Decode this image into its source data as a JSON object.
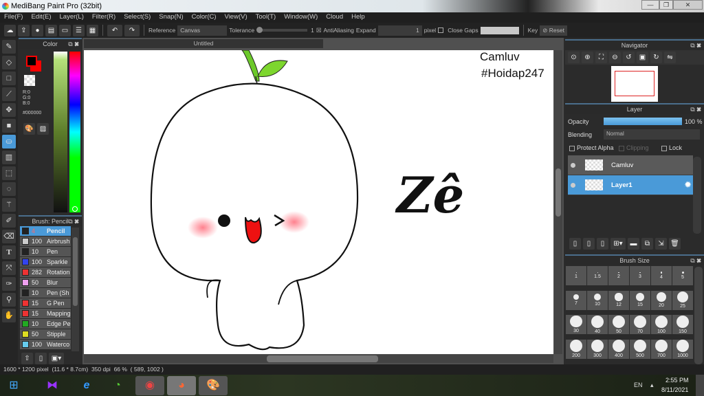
{
  "window": {
    "title": "MediBang Paint Pro (32bit)",
    "minimize": "—",
    "restore": "❐",
    "close": "✕"
  },
  "menu": [
    "File(F)",
    "Edit(E)",
    "Layer(L)",
    "Filter(R)",
    "Select(S)",
    "Snap(N)",
    "Color(C)",
    "View(V)",
    "Tool(T)",
    "Window(W)",
    "Cloud",
    "Help"
  ],
  "toolbar": {
    "reference_label": "Reference",
    "reference_value": "Canvas",
    "tolerance_label": "Tolerance",
    "tolerance_value": "1",
    "antialiasing_label": "AntiAliasing",
    "antialiasing_checked": true,
    "expand_label": "Expand",
    "expand_value": "1",
    "expand_unit": "pixel",
    "close_gaps_label": "Close Gaps",
    "close_gaps_checked": false,
    "key_label": "Key",
    "reset_label": "Reset"
  },
  "color_panel": {
    "title": "Color",
    "r": "R:0",
    "g": "G:0",
    "b": "B:0",
    "hex": "#000000",
    "foreground": "#000000",
    "background": "#ff0000"
  },
  "canvas": {
    "tab": "Untitled",
    "text1": "Camluv",
    "text2": "#Hoidap247",
    "calligraphy": "Zê"
  },
  "brush_panel": {
    "title": "Brush: Pencil",
    "items": [
      {
        "size": "4",
        "name": "Pencil",
        "color": "#222222",
        "selected": true
      },
      {
        "size": "100",
        "name": "Airbrush",
        "color": "#cccccc"
      },
      {
        "size": "10",
        "name": "Pen",
        "color": "#222222"
      },
      {
        "size": "100",
        "name": "Sparkle",
        "color": "#3344ee"
      },
      {
        "size": "282",
        "name": "Rotation",
        "color": "#ee3333"
      },
      {
        "size": "50",
        "name": "Blur",
        "color": "#f0a0f0"
      },
      {
        "size": "10",
        "name": "Pen (Sh",
        "color": "#222222"
      },
      {
        "size": "15",
        "name": "G Pen",
        "color": "#ee3333"
      },
      {
        "size": "15",
        "name": "Mapping",
        "color": "#ee3333"
      },
      {
        "size": "10",
        "name": "Edge Pe",
        "color": "#22aa22"
      },
      {
        "size": "50",
        "name": "Stipple",
        "color": "#dddd22"
      },
      {
        "size": "100",
        "name": "Waterco",
        "color": "#66ccee"
      }
    ]
  },
  "navigator": {
    "title": "Navigator"
  },
  "layer_panel": {
    "title": "Layer",
    "opacity_label": "Opacity",
    "opacity_value": "100 %",
    "opacity": 100,
    "blending_label": "Blending",
    "blending_value": "Normal",
    "protect_alpha": "Protect Alpha",
    "clipping": "Clipping",
    "lock": "Lock",
    "layers": [
      {
        "name": "Camluv",
        "selected": false
      },
      {
        "name": "Layer1",
        "selected": true
      }
    ]
  },
  "brush_size": {
    "title": "Brush Size",
    "sizes": [
      "1",
      "1.5",
      "2",
      "3",
      "4",
      "5",
      "7",
      "10",
      "12",
      "15",
      "20",
      "25",
      "30",
      "40",
      "50",
      "70",
      "100",
      "150",
      "200",
      "300",
      "400",
      "500",
      "700",
      "1000"
    ]
  },
  "status": {
    "dimensions": "1600 * 1200 pixel",
    "physical": "(11.6 * 8.7cm)",
    "dpi": "350 dpi",
    "zoom": "66 %",
    "coords": "( 589, 1002 )"
  },
  "taskbar": {
    "lang": "EN",
    "time": "2:55 PM",
    "date": "8/11/2021"
  }
}
